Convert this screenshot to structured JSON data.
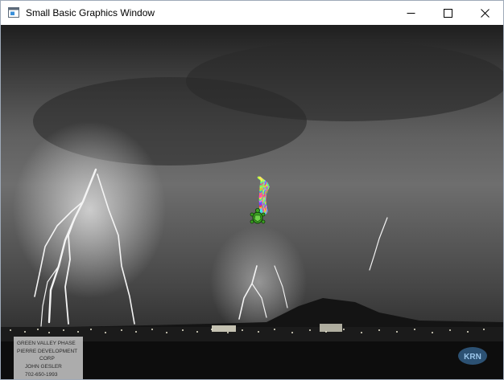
{
  "window": {
    "title": "Small Basic Graphics Window",
    "icon": "small-basic-app-icon"
  },
  "titlebar_buttons": [
    {
      "name": "minimize",
      "icon": "minimize-icon"
    },
    {
      "name": "maximize",
      "icon": "maximize-icon"
    },
    {
      "name": "close",
      "icon": "close-icon"
    }
  ],
  "canvas": {
    "background": "grayscale photo: night thunderstorm with lightning bolts over a city skyline",
    "sign_text": [
      "GREEN VALLEY PHASE",
      "PIERRE DEVELOPMENT",
      "CORP",
      "JOHN GESLER",
      "702-650-1993"
    ],
    "watermark": "KRN",
    "turtle_icon": "turtle-icon",
    "drawing": "spiral of colored polygons drawn by the turtle"
  },
  "colors": {
    "polygon_colors": [
      "#ff3b3b",
      "#ffd23b",
      "#7cff3b",
      "#3bffb0",
      "#3bb0ff",
      "#7c3bff",
      "#ff3bd2",
      "#ff9c3b",
      "#c8ff3b",
      "#3bffe7",
      "#5a5aff",
      "#ff5a9c",
      "#9cff5a",
      "#ffe75a",
      "#5ac8ff",
      "#e75aff",
      "#ff7c5a",
      "#5aff7c",
      "#b03bff",
      "#ffb03b",
      "#3bff7c",
      "#3b7cff",
      "#ff3b7c",
      "#d2ff3b"
    ],
    "turtle": "#3aa022"
  }
}
